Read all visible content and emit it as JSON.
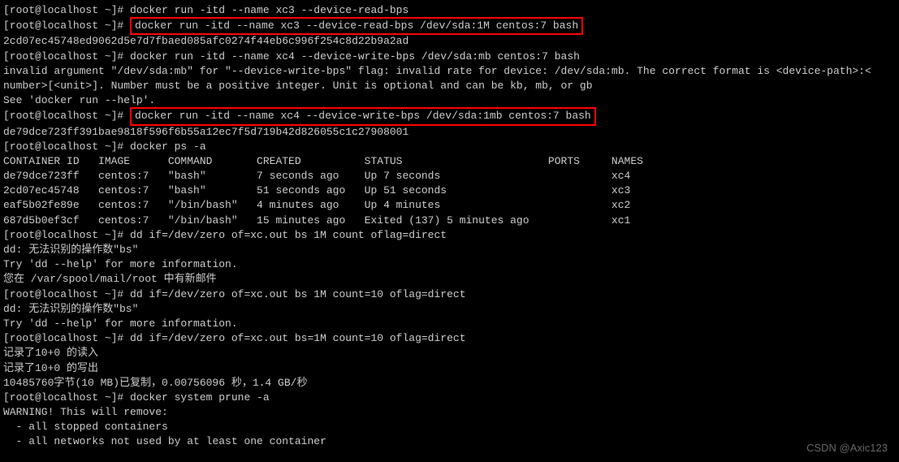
{
  "lines": {
    "l0": "[root@localhost ~]# docker run -itd --name xc3 --device-read-bps",
    "l1_prefix": "[root@localhost ~]# ",
    "l1_cmd": "docker run -itd --name xc3 --device-read-bps /dev/sda:1M centos:7 bash",
    "l2": "2cd07ec45748ed9062d5e7d7fbaed085afc0274f44eb6c996f254c8d22b9a2ad",
    "l3": "[root@localhost ~]# docker run -itd --name xc4 --device-write-bps /dev/sda:mb centos:7 bash",
    "l4": "invalid argument \"/dev/sda:mb\" for \"--device-write-bps\" flag: invalid rate for device: /dev/sda:mb. The correct format is <device-path>:<",
    "l5": "number>[<unit>]. Number must be a positive integer. Unit is optional and can be kb, mb, or gb",
    "l6": "See 'docker run --help'.",
    "l7_prefix": "[root@localhost ~]# ",
    "l7_cmd": "docker run -itd --name xc4 --device-write-bps /dev/sda:1mb centos:7 bash",
    "l8": "de79dce723ff391bae9818f596f6b55a12ec7f5d719b42d826055c1c27908001",
    "l9": "[root@localhost ~]# docker ps -a",
    "th": "CONTAINER ID   IMAGE      COMMAND       CREATED          STATUS                       PORTS     NAMES",
    "tr1": "de79dce723ff   centos:7   \"bash\"        7 seconds ago    Up 7 seconds                           xc4",
    "tr2": "2cd07ec45748   centos:7   \"bash\"        51 seconds ago   Up 51 seconds                          xc3",
    "tr3": "eaf5b02fe89e   centos:7   \"/bin/bash\"   4 minutes ago    Up 4 minutes                           xc2",
    "tr4": "687d5b0ef3cf   centos:7   \"/bin/bash\"   15 minutes ago   Exited (137) 5 minutes ago             xc1",
    "l10": "[root@localhost ~]# dd if=/dev/zero of=xc.out bs 1M count oflag=direct",
    "l11": "dd: 无法识别的操作数\"bs\"",
    "l12": "Try 'dd --help' for more information.",
    "l13": "您在 /var/spool/mail/root 中有新邮件",
    "l14": "[root@localhost ~]# dd if=/dev/zero of=xc.out bs 1M count=10 oflag=direct",
    "l15": "dd: 无法识别的操作数\"bs\"",
    "l16": "Try 'dd --help' for more information.",
    "l17": "[root@localhost ~]# dd if=/dev/zero of=xc.out bs=1M count=10 oflag=direct",
    "l18": "记录了10+0 的读入",
    "l19": "记录了10+0 的写出",
    "l20": "10485760字节(10 MB)已复制，0.00756096 秒，1.4 GB/秒",
    "l21": "[root@localhost ~]# docker system prune -a",
    "l22": "WARNING! This will remove:",
    "l23": "  - all stopped containers",
    "l24": "  - all networks not used by at least one container"
  },
  "watermark": "CSDN @Axic123"
}
